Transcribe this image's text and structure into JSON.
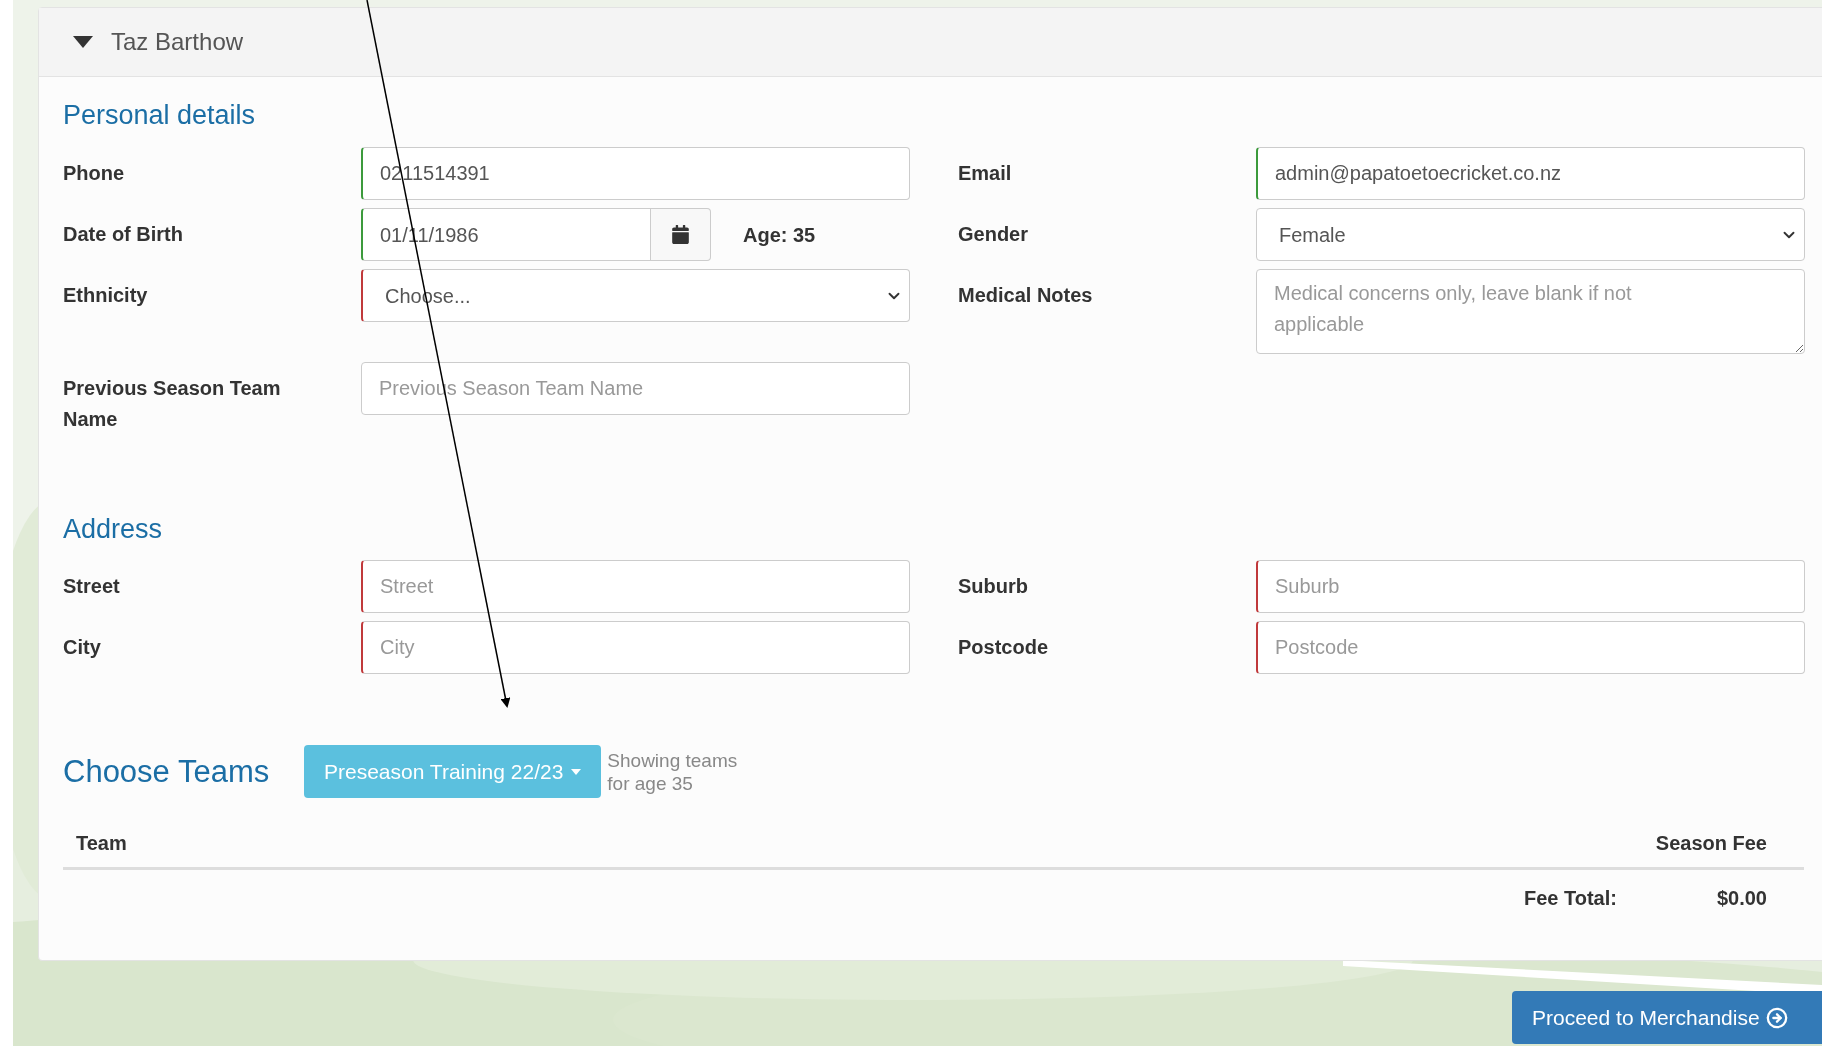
{
  "panel": {
    "title": "Taz Barthow",
    "expanded": true
  },
  "personal_details": {
    "heading": "Personal details",
    "rows": [
      {
        "left": {
          "label": "Phone",
          "kind": "text",
          "value": "0211514391",
          "valid": true,
          "error": false
        },
        "right": {
          "label": "Email",
          "kind": "text",
          "value": "admin@papatoetoecricket.co.nz",
          "valid": true,
          "error": false
        }
      },
      {
        "left": {
          "label": "Date of Birth",
          "kind": "date",
          "value": "01/11/1986",
          "valid": true,
          "error": false,
          "age": "Age: 35"
        },
        "right": {
          "label": "Gender",
          "kind": "select",
          "value": "Female",
          "valid": false,
          "error": false
        }
      },
      {
        "left": {
          "label": "Ethnicity",
          "kind": "select",
          "value": "Choose...",
          "valid": false,
          "error": true
        },
        "right": {
          "label": "Medical Notes",
          "kind": "textarea",
          "placeholder": "Medical concerns only, leave blank if not applicable",
          "valid": false,
          "error": false
        }
      },
      {
        "left": {
          "label": "Previous Season Team Name",
          "kind": "text",
          "placeholder": "Previous Season Team Name",
          "valid": false,
          "error": false
        }
      }
    ]
  },
  "address": {
    "heading": "Address",
    "rows": [
      {
        "left": {
          "label": "Street",
          "kind": "text",
          "placeholder": "Street",
          "valid": false,
          "error": true
        },
        "right": {
          "label": "Suburb",
          "kind": "text",
          "placeholder": "Suburb",
          "valid": false,
          "error": true
        }
      },
      {
        "left": {
          "label": "City",
          "kind": "text",
          "placeholder": "City",
          "valid": false,
          "error": true
        },
        "right": {
          "label": "Postcode",
          "kind": "text",
          "placeholder": "Postcode",
          "valid": false,
          "error": true
        }
      }
    ]
  },
  "choose_teams": {
    "heading": "Choose Teams",
    "season_button": "Preseason Training 22/23",
    "note": "Showing teams for age 35",
    "table": {
      "columns": [
        "Team",
        "Season Fee"
      ],
      "fee_total_label": "Fee Total:",
      "fee_total": "$0.00"
    }
  },
  "proceed_button": "Proceed to Merchandise"
}
